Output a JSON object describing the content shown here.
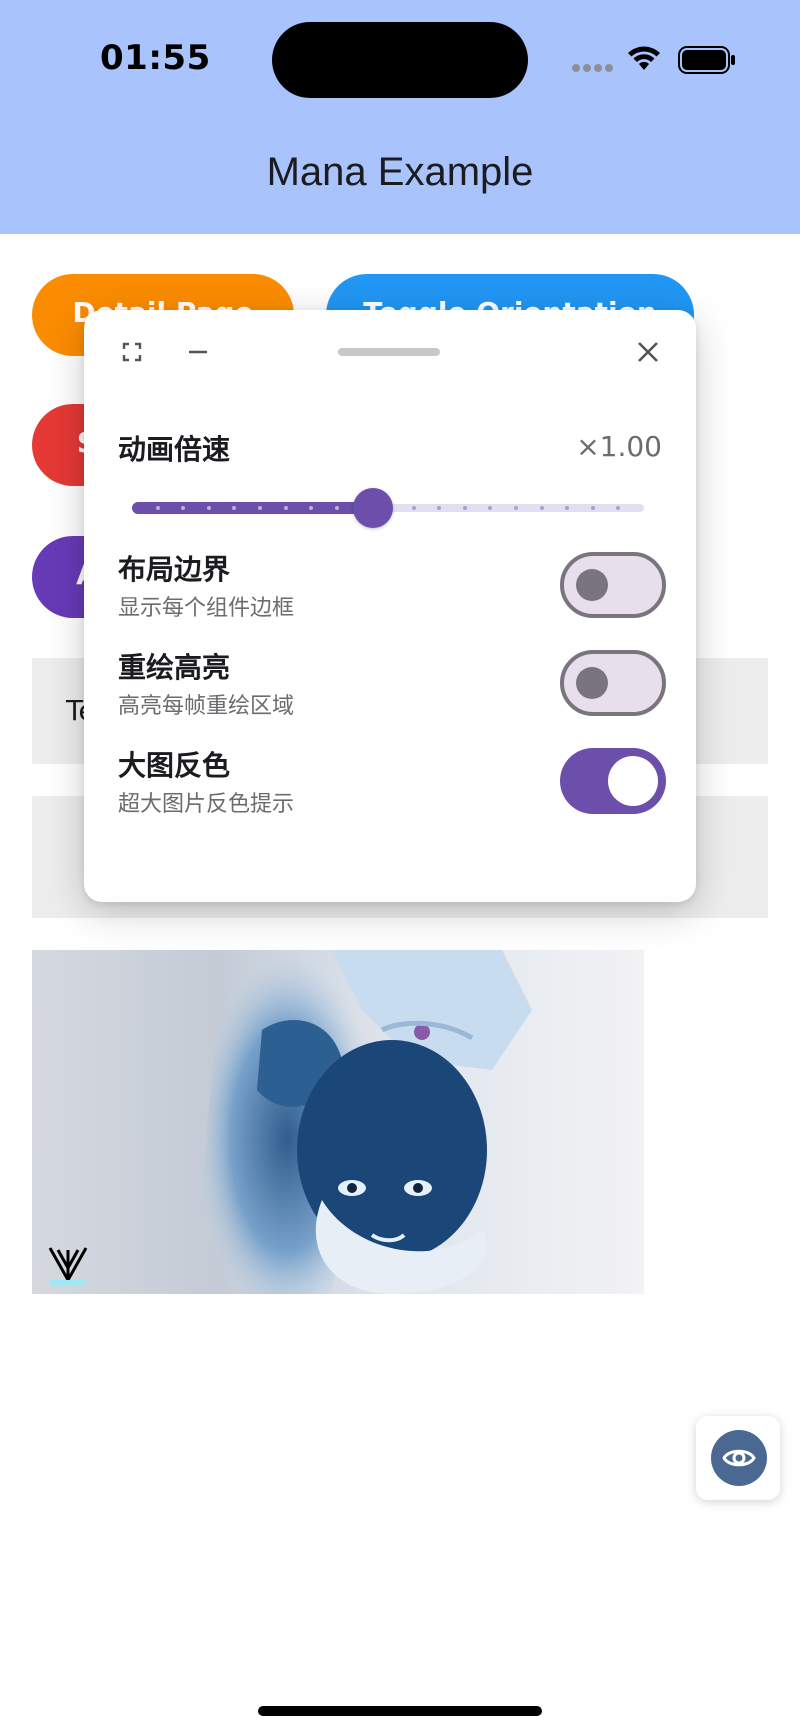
{
  "status_bar": {
    "time": "01:55"
  },
  "app_bar": {
    "title": "Mana Example"
  },
  "background_page": {
    "buttons": [
      {
        "label": "Detail Page",
        "color": "#fb8c00"
      },
      {
        "label": "Toggle Orientation",
        "color": "#2196f3"
      },
      {
        "label": "S",
        "color": "#e53935"
      },
      {
        "label": "A",
        "color": "#673ab7"
      }
    ],
    "box_text": "Te",
    "image_icon": "inverted-photo",
    "fab_icon": "eye-icon"
  },
  "panel": {
    "icons": [
      "expand-icon",
      "minimize-icon",
      "drag-handle",
      "close-icon"
    ],
    "speed": {
      "label": "动画倍速",
      "value_text": "×1.00",
      "slider_fraction": 0.47,
      "divisions": 20,
      "accent": "#6b4fab"
    },
    "toggles": [
      {
        "title": "布局边界",
        "subtitle": "显示每个组件边框",
        "on": false
      },
      {
        "title": "重绘高亮",
        "subtitle": "高亮每帧重绘区域",
        "on": false
      },
      {
        "title": "大图反色",
        "subtitle": "超大图片反色提示",
        "on": true
      }
    ]
  }
}
